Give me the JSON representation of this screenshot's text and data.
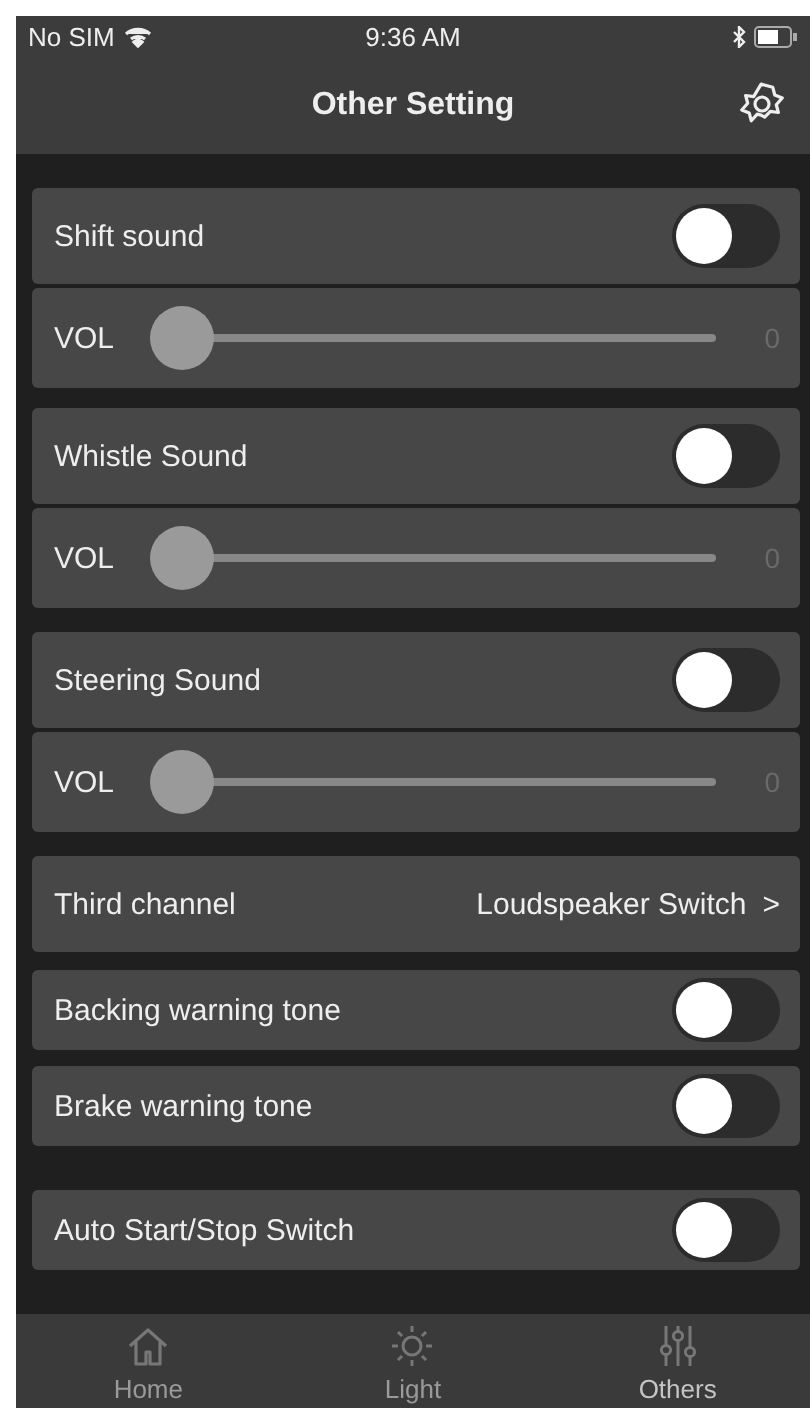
{
  "status_bar": {
    "carrier": "No SIM",
    "time": "9:36 AM"
  },
  "nav_bar": {
    "title": "Other Setting"
  },
  "groups": [
    {
      "rows": [
        {
          "kind": "toggle",
          "label": "Shift sound",
          "on": false
        },
        {
          "kind": "slider",
          "label": "VOL",
          "level": 0,
          "reading": "0"
        }
      ]
    },
    {
      "rows": [
        {
          "kind": "toggle",
          "label": "Whistle Sound",
          "on": false
        },
        {
          "kind": "slider",
          "label": "VOL",
          "level": 0,
          "reading": "0"
        }
      ]
    },
    {
      "rows": [
        {
          "kind": "toggle",
          "label": "Steering Sound",
          "on": false
        },
        {
          "kind": "slider",
          "label": "VOL",
          "level": 0,
          "reading": "0"
        }
      ]
    },
    {
      "rows": [
        {
          "kind": "link",
          "label": "Third channel",
          "value": "Loudspeaker Switch",
          "chevron": ">"
        }
      ]
    },
    {
      "rows": [
        {
          "kind": "toggle",
          "label": "Backing warning tone",
          "on": false
        }
      ]
    },
    {
      "rows": [
        {
          "kind": "toggle",
          "label": "Brake warning tone",
          "on": false
        }
      ]
    },
    {
      "rows": [
        {
          "kind": "toggle",
          "label": "Auto Start/Stop Switch",
          "on": false
        }
      ]
    }
  ],
  "tab_bar": [
    {
      "label": "Home",
      "selected": false
    },
    {
      "label": "Light",
      "selected": false
    },
    {
      "label": "Others",
      "selected": true
    }
  ]
}
